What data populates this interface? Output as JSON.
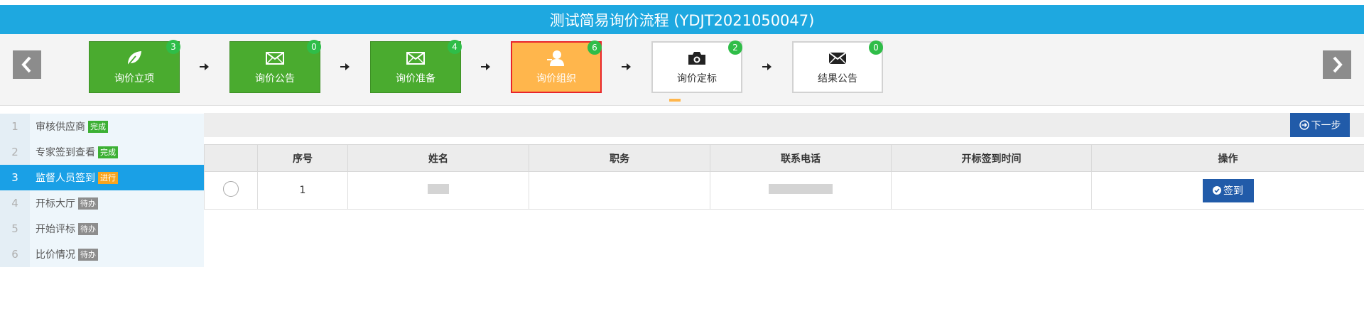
{
  "header": {
    "title": "测试简易询价流程 (YDJT2021050047)"
  },
  "steps": [
    {
      "label": "询价立项",
      "count": "3",
      "icon": "leaf-icon",
      "state": "done"
    },
    {
      "label": "询价公告",
      "count": "0",
      "icon": "envelope-icon",
      "state": "done"
    },
    {
      "label": "询价准备",
      "count": "4",
      "icon": "envelope-icon",
      "state": "done"
    },
    {
      "label": "询价组织",
      "count": "6",
      "icon": "user-icon",
      "state": "current"
    },
    {
      "label": "询价定标",
      "count": "2",
      "icon": "camera-icon",
      "state": "todo"
    },
    {
      "label": "结果公告",
      "count": "0",
      "icon": "envelope-icon",
      "state": "todo"
    }
  ],
  "sidebar": {
    "items": [
      {
        "num": "1",
        "label": "审核供应商",
        "tag": "完成",
        "status": "done"
      },
      {
        "num": "2",
        "label": "专家签到查看",
        "tag": "完成",
        "status": "done"
      },
      {
        "num": "3",
        "label": "监督人员签到",
        "tag": "进行",
        "status": "active"
      },
      {
        "num": "4",
        "label": "开标大厅",
        "tag": "待办",
        "status": "todo"
      },
      {
        "num": "5",
        "label": "开始评标",
        "tag": "待办",
        "status": "todo"
      },
      {
        "num": "6",
        "label": "比价情况",
        "tag": "待办",
        "status": "todo"
      }
    ]
  },
  "toolbar": {
    "next_label": "下一步"
  },
  "table": {
    "headers": [
      "",
      "序号",
      "姓名",
      "职务",
      "联系电话",
      "开标签到时间",
      "操作"
    ],
    "rows": [
      {
        "index": "1",
        "action_label": "签到"
      }
    ]
  },
  "colors": {
    "title_bar": "#1ea8e0",
    "step_done": "#4aab2f",
    "step_current": "#ffb64c",
    "step_current_border": "#e8242b",
    "badge": "#2fbd48",
    "sidebar_active": "#1aa0e6",
    "tag_done": "#3cb034",
    "tag_active": "#f7a51f",
    "tag_todo": "#8d8d8d",
    "primary_button": "#215ba9"
  }
}
